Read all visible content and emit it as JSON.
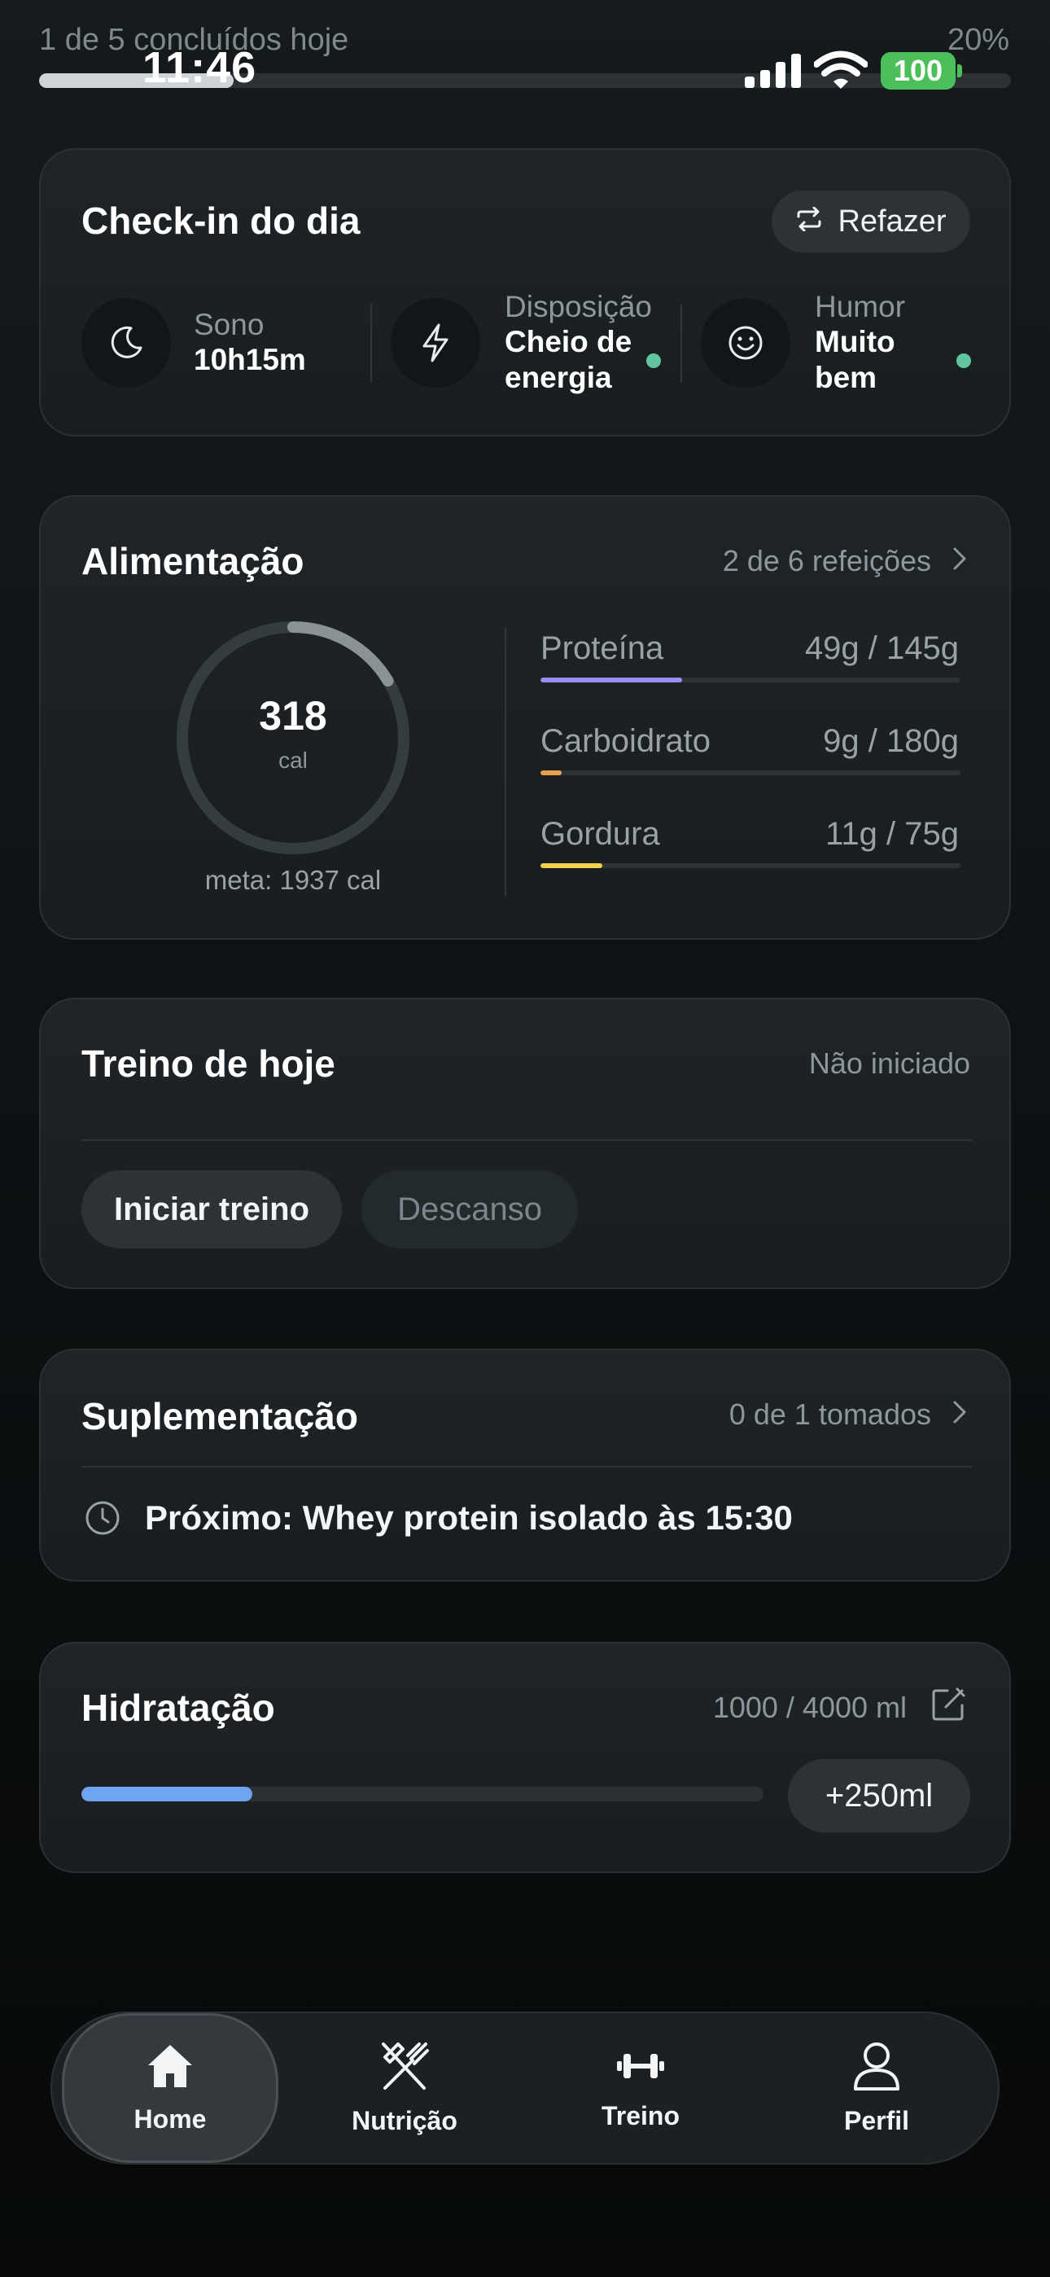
{
  "status_bar": {
    "daily_progress_label": "1 de 5 concluídos hoje",
    "daily_progress_percent": "20%",
    "daily_progress_value": 0.2,
    "time": "11:46",
    "battery": "100",
    "icons": [
      "signal-icon",
      "wifi-icon",
      "battery-icon"
    ]
  },
  "checkin": {
    "title": "Check-in do dia",
    "redo_label": "Refazer",
    "items": [
      {
        "icon": "moon-icon",
        "label": "Sono",
        "value": "10h15m"
      },
      {
        "icon": "lightning-icon",
        "label": "Disposição",
        "value_line1": "Cheio de",
        "value_line2": "energia"
      },
      {
        "icon": "smile-icon",
        "label": "Humor",
        "value_line1": "Muito",
        "value_line2": "bem"
      }
    ],
    "status_color": "#5fc6a0"
  },
  "nutrition": {
    "title": "Alimentação",
    "meals_label": "2 de 6 refeições",
    "calories": "318",
    "calories_unit": "cal",
    "calories_progress": 0.164,
    "goal_label": "meta: 1937 cal",
    "macros": [
      {
        "name": "Proteína",
        "value": "49g / 145g",
        "progress": 0.338,
        "color": "#9b8cf0"
      },
      {
        "name": "Carboidrato",
        "value": "9g / 180g",
        "progress": 0.05,
        "color": "#e8a24a"
      },
      {
        "name": "Gordura",
        "value": "11g / 75g",
        "progress": 0.147,
        "color": "#f2d24a"
      }
    ]
  },
  "workout": {
    "title": "Treino de hoje",
    "status": "Não iniciado",
    "start_label": "Iniciar treino",
    "rest_label": "Descanso"
  },
  "supplements": {
    "title": "Suplementação",
    "taken_label": "0 de 1 tomados",
    "next_label": "Próximo: Whey protein isolado às 15:30"
  },
  "hydration": {
    "title": "Hidratação",
    "amount_label": "1000 / 4000 ml",
    "progress": 0.25,
    "add_label": "+250ml",
    "bar_color": "#6fa4f0"
  },
  "nav": {
    "items": [
      {
        "icon": "home-icon",
        "label": "Home",
        "active": true
      },
      {
        "icon": "utensils-icon",
        "label": "Nutrição",
        "active": false
      },
      {
        "icon": "dumbbell-icon",
        "label": "Treino",
        "active": false
      },
      {
        "icon": "user-icon",
        "label": "Perfil",
        "active": false
      }
    ]
  }
}
